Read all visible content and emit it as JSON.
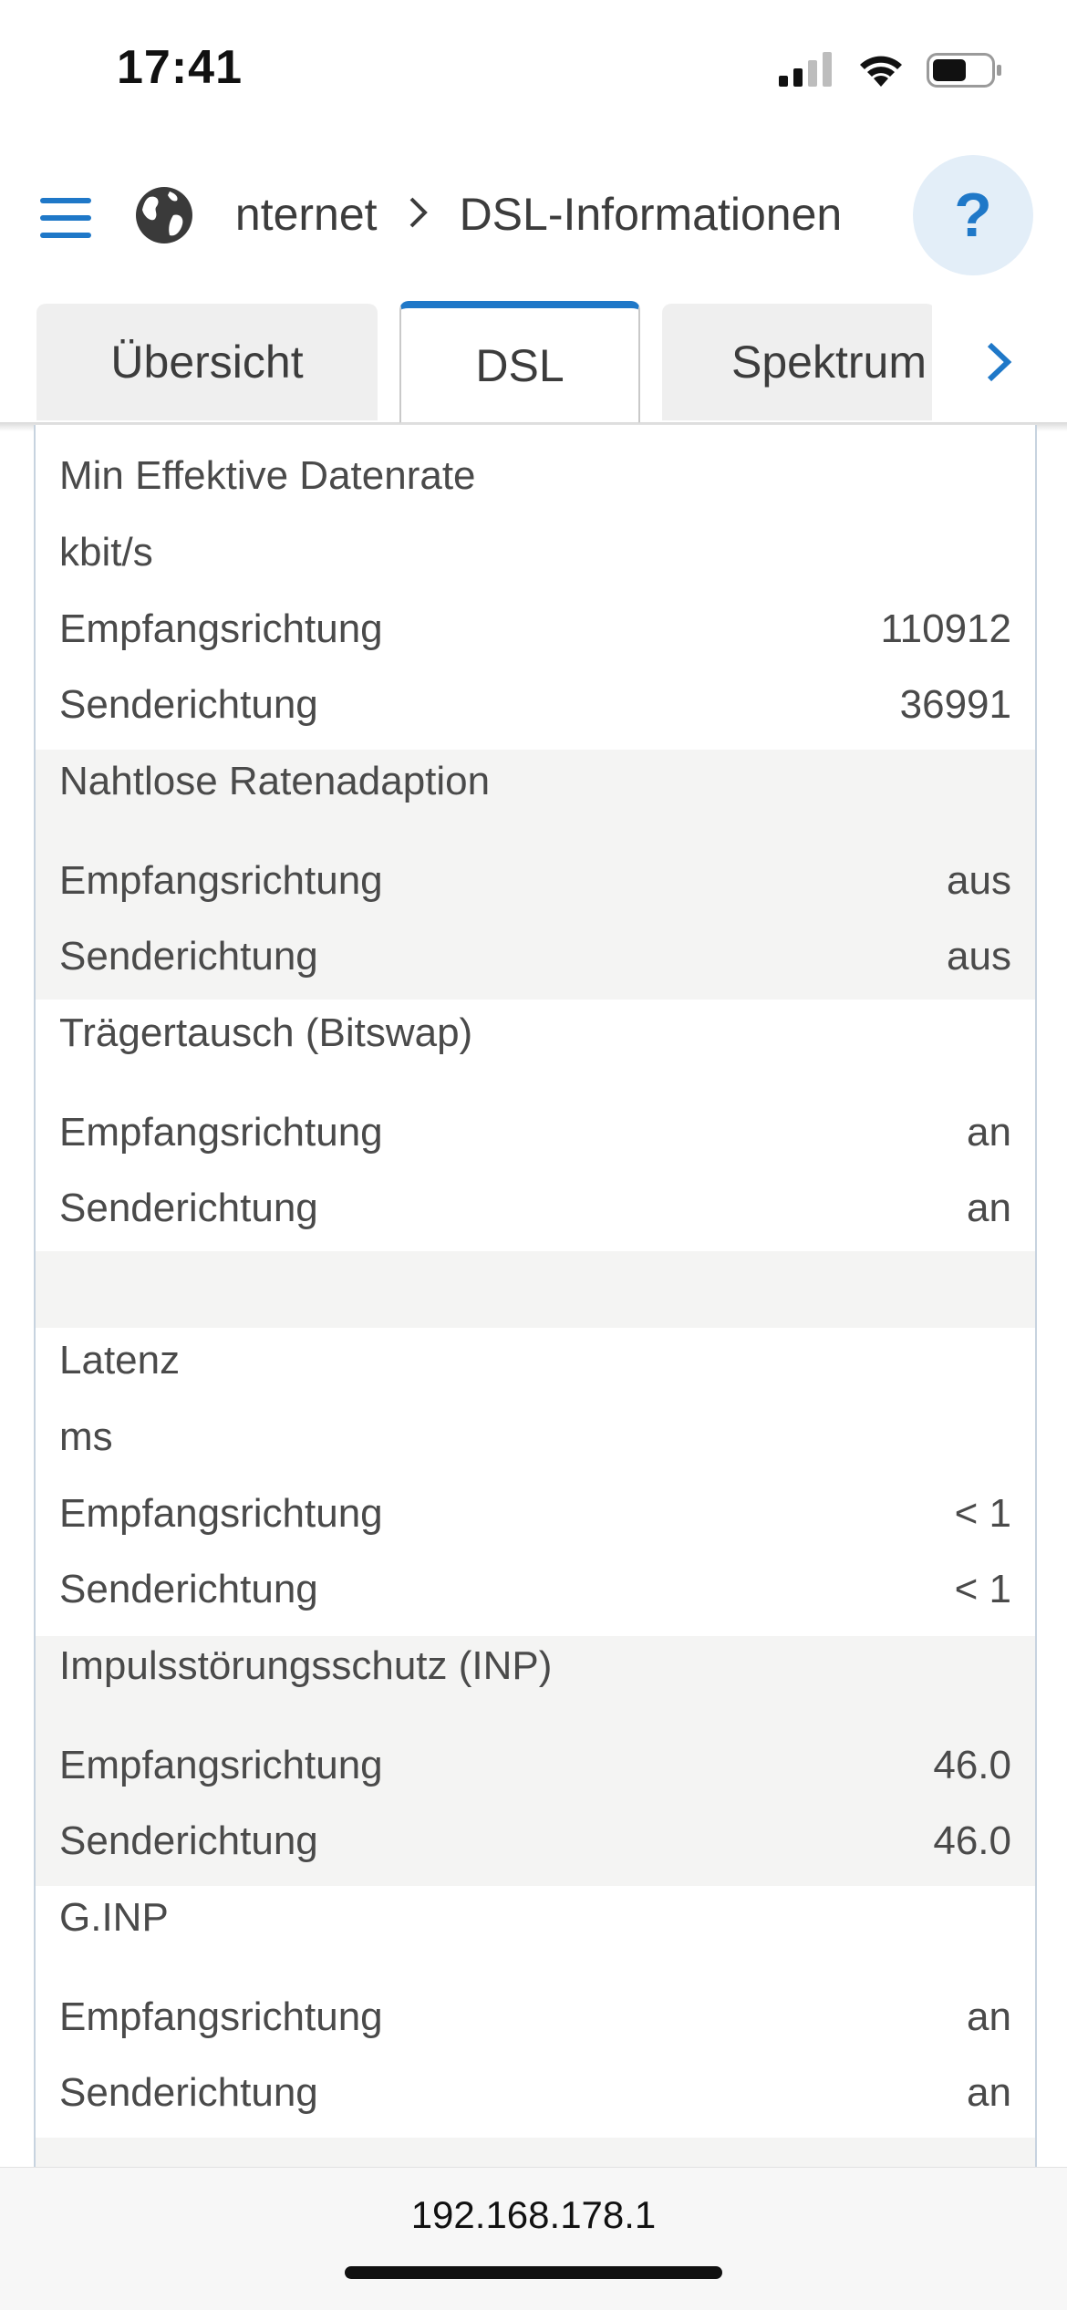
{
  "status_bar": {
    "time": "17:41"
  },
  "header": {
    "breadcrumb": [
      "Internet",
      "DSL-Informationen"
    ],
    "help_label": "?"
  },
  "tabs": [
    {
      "label": "Übersicht",
      "active": false
    },
    {
      "label": "DSL",
      "active": true
    },
    {
      "label": "Spektrum",
      "active": false
    }
  ],
  "rows": {
    "r0_label": "Min Effektive Datenrate",
    "r1_label": "kbit/s",
    "r2_label": "Empfangsrichtung",
    "r2_value": "110912",
    "r3_label": "Senderichtung",
    "r3_value": "36991",
    "r4_label": "Nahtlose Ratenadaption",
    "r5_label": "Empfangsrichtung",
    "r5_value": "aus",
    "r6_label": "Senderichtung",
    "r6_value": "aus",
    "r7_label": "Trägertausch (Bitswap)",
    "r8_label": "Empfangsrichtung",
    "r8_value": "an",
    "r9_label": "Senderichtung",
    "r9_value": "an",
    "r10_label": "Latenz",
    "r11_label": "ms",
    "r12_label": "Empfangsrichtung",
    "r12_value": "< 1",
    "r13_label": "Senderichtung",
    "r13_value": "< 1",
    "r14_label": "Impulsstörungsschutz (INP)",
    "r15_label": "Empfangsrichtung",
    "r15_value": "46.0",
    "r16_label": "Senderichtung",
    "r16_value": "46.0",
    "r17_label": "G.INP",
    "r18_label": "Empfangsrichtung",
    "r18_value": "an",
    "r19_label": "Senderichtung",
    "r19_value": "an"
  },
  "bottom_bar": {
    "url": "192.168.178.1"
  },
  "colors": {
    "accent": "#1f78c8",
    "band": "#f4f4f3",
    "help_bg": "#e3eef8"
  },
  "icons": [
    "menu-icon",
    "globe-icon",
    "chevron-right-icon",
    "signal-icon",
    "wifi-icon",
    "battery-icon"
  ]
}
